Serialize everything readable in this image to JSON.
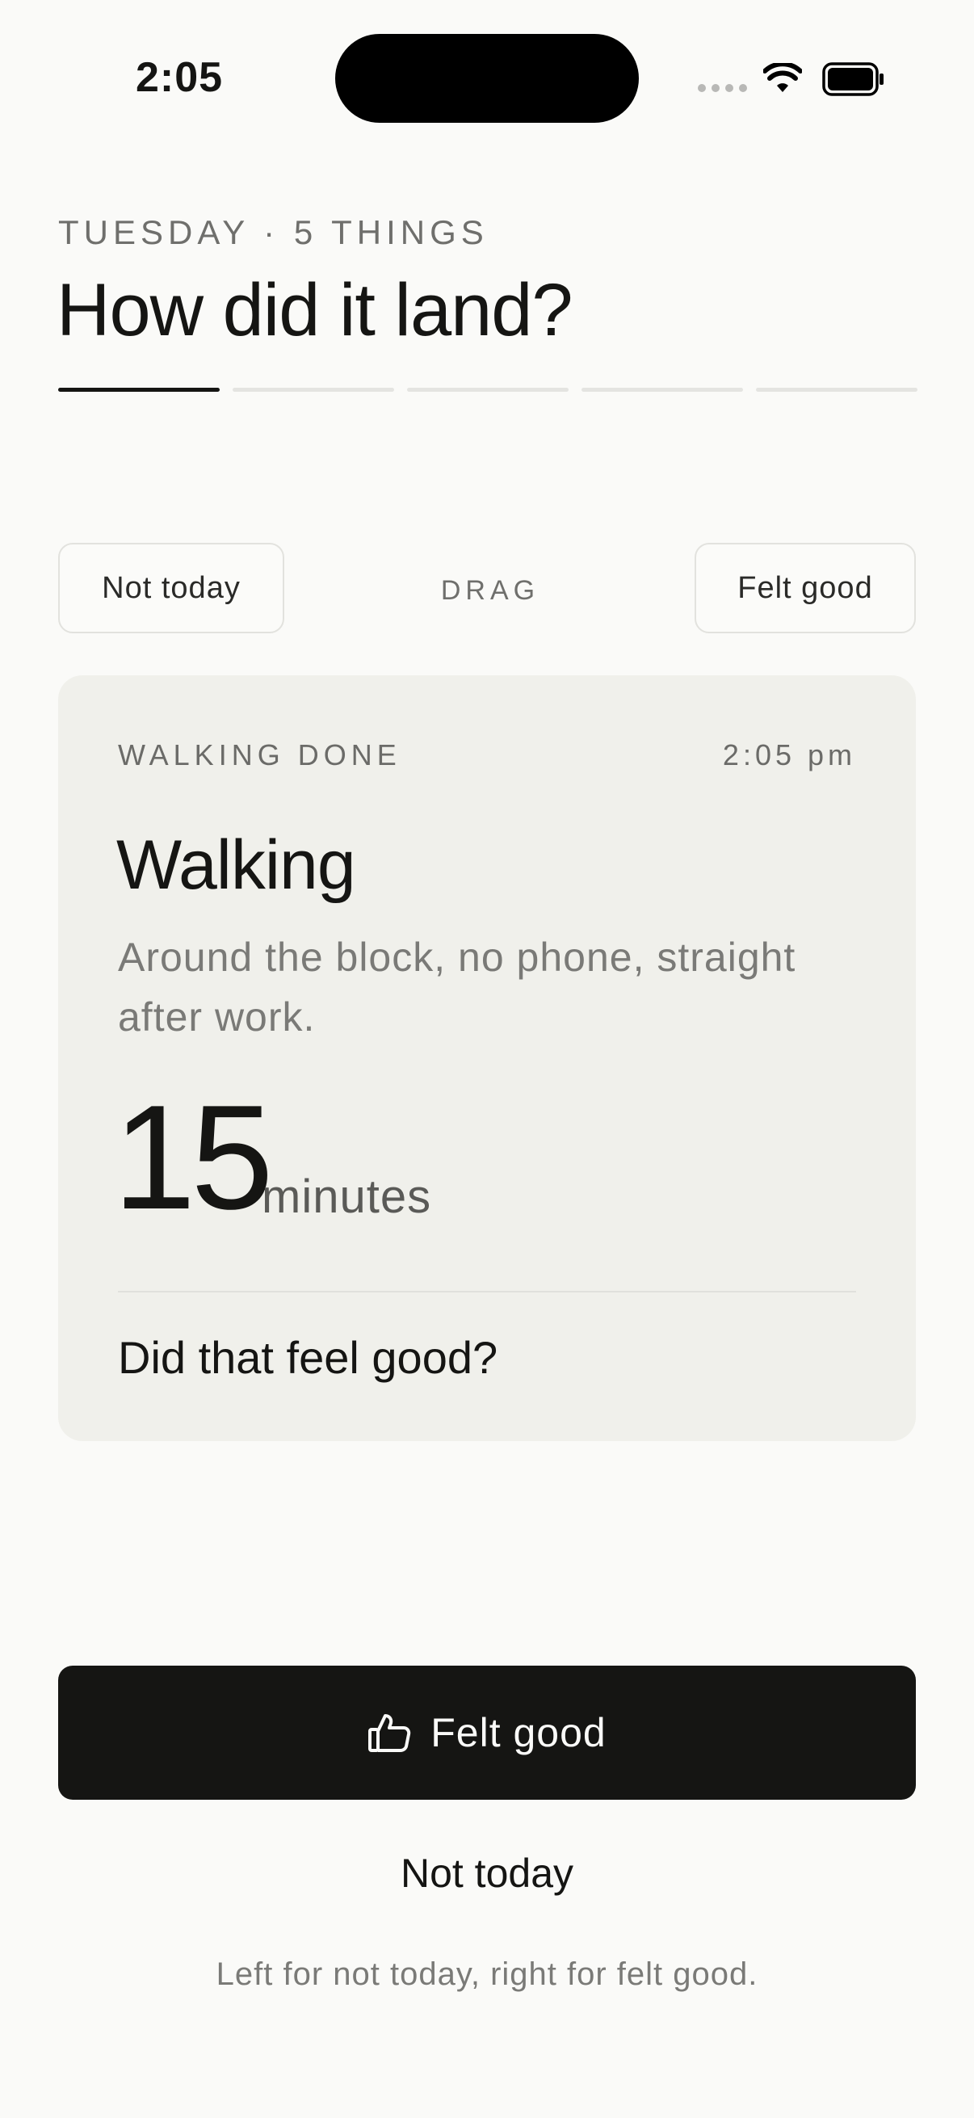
{
  "status_bar": {
    "time": "2:05"
  },
  "header": {
    "eyebrow": "TUESDAY · 5 THINGS",
    "title": "How did it land?",
    "progress": {
      "total_steps": 5,
      "current_step": 1
    }
  },
  "swipe_hints": {
    "left_label": "Not today",
    "center_label": "DRAG",
    "right_label": "Felt good"
  },
  "card": {
    "label": "WALKING DONE",
    "time": "2:05 pm",
    "title": "Walking",
    "description": "Around the block, no phone, straight after work.",
    "value": "15",
    "unit": "minutes",
    "question": "Did that feel good?"
  },
  "actions": {
    "primary_label": "Felt good",
    "primary_icon": "thumbs-up-icon",
    "secondary_label": "Not today",
    "hint": "Left for not today, right for felt good."
  },
  "colors": {
    "background": "#fafaf8",
    "card": "#f0f0eb",
    "primary_button": "#151513",
    "muted_text": "#6f6f6c"
  }
}
